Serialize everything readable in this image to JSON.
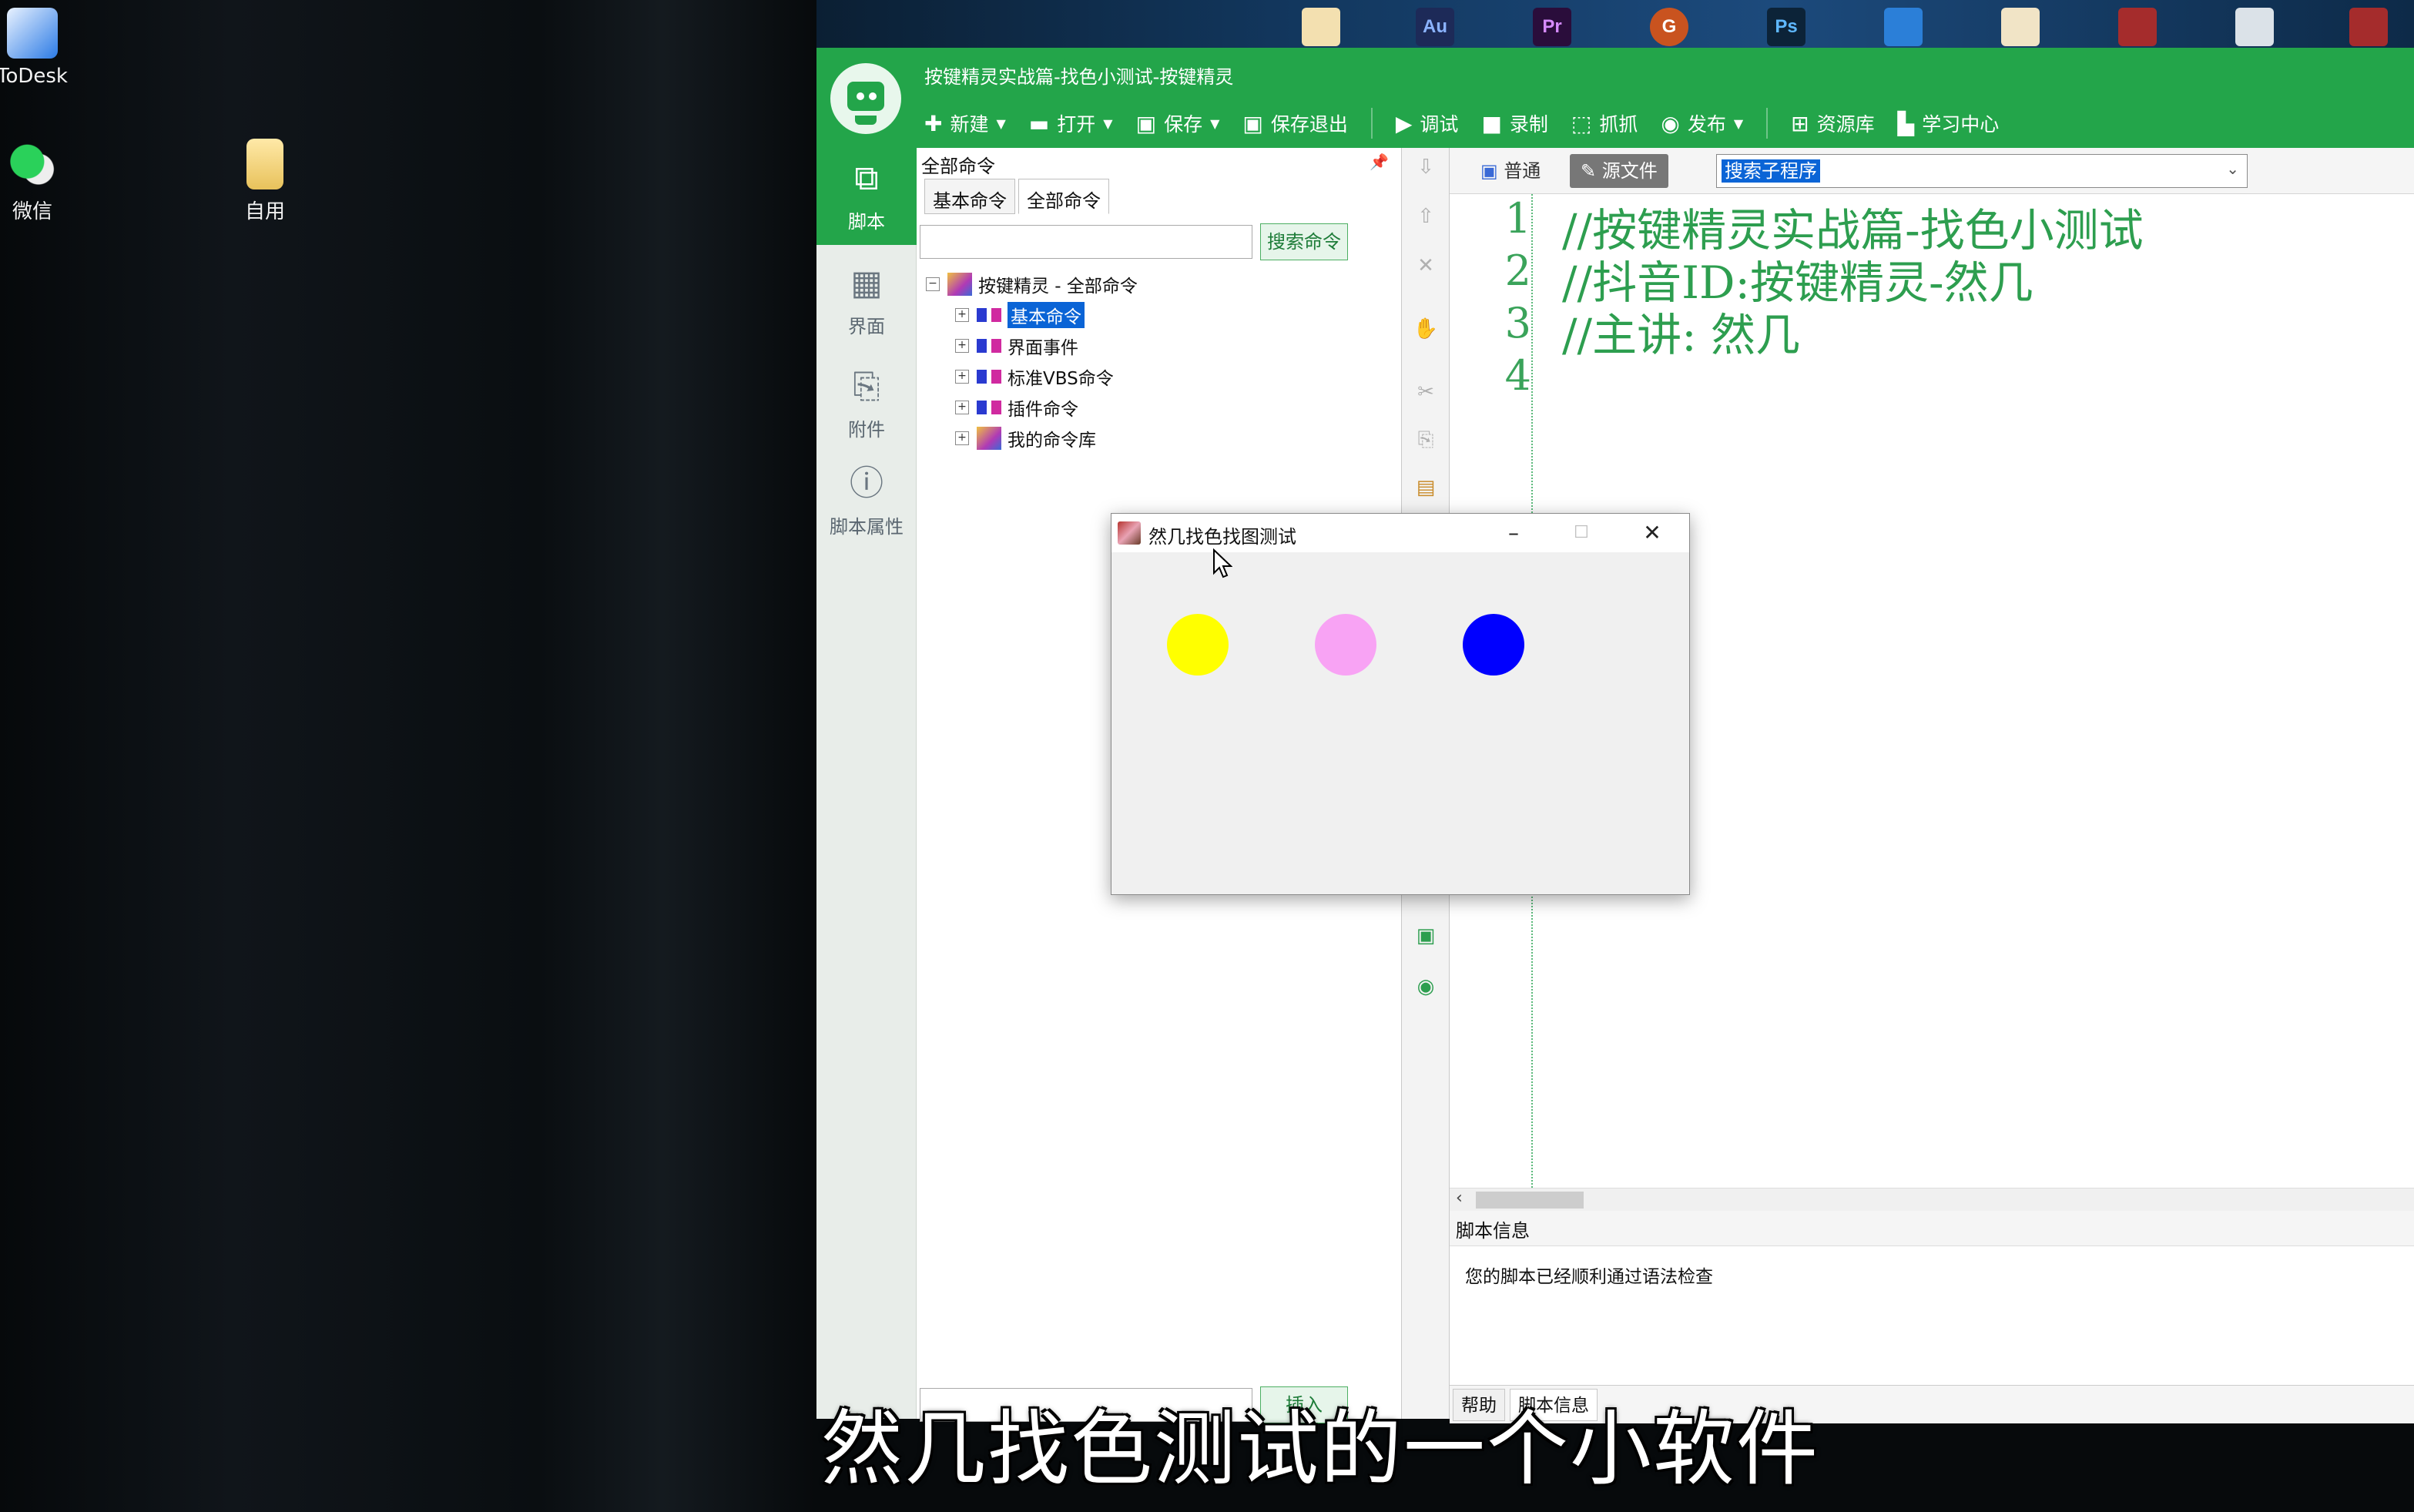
{
  "desktop": {
    "icons": [
      {
        "label": "ToDesk"
      },
      {
        "label": "微信"
      },
      {
        "label": "自用"
      }
    ],
    "taskbar": [
      "Au",
      "Pr",
      "G",
      "Ps"
    ]
  },
  "window": {
    "title": "按键精灵实战篇-找色小测试-按键精灵",
    "toolbar": [
      {
        "label": "新建",
        "icon": "plus-icon"
      },
      {
        "label": "打开",
        "icon": "folder-icon"
      },
      {
        "label": "保存",
        "icon": "save-icon"
      },
      {
        "label": "保存退出",
        "icon": "save-exit-icon"
      },
      {
        "label": "调试",
        "icon": "play-icon"
      },
      {
        "label": "录制",
        "icon": "record-icon"
      },
      {
        "label": "抓抓",
        "icon": "capture-icon"
      },
      {
        "label": "发布",
        "icon": "publish-icon"
      },
      {
        "label": "资源库",
        "icon": "library-icon"
      },
      {
        "label": "学习中心",
        "icon": "learn-icon"
      }
    ]
  },
  "nav": [
    {
      "label": "脚本",
      "active": true
    },
    {
      "label": "界面"
    },
    {
      "label": "附件"
    },
    {
      "label": "脚本属性"
    }
  ],
  "commands": {
    "header": "全部命令",
    "tabs": [
      "基本命令",
      "全部命令"
    ],
    "search_button": "搜索命令",
    "insert_button": "插入",
    "tree_root": "按键精灵 - 全部命令",
    "tree_items": [
      "基本命令",
      "界面事件",
      "标准VBS命令",
      "插件命令",
      "我的命令库"
    ]
  },
  "editor": {
    "mode_normal": "普通",
    "mode_source": "源文件",
    "sub_select": "搜索子程序",
    "lines": [
      {
        "n": "1",
        "text": "//按键精灵实战篇-找色小测试"
      },
      {
        "n": "2",
        "text": "//抖音ID:按键精灵-然几"
      },
      {
        "n": "3",
        "text": "//主讲: 然几"
      },
      {
        "n": "4",
        "text": ""
      }
    ],
    "info_header": "脚本信息",
    "info_message": "您的脚本已经顺利通过语法检查",
    "bottom_tabs": [
      "帮助",
      "脚本信息"
    ]
  },
  "popup": {
    "title": "然几找色找图测试",
    "circles": [
      {
        "color": "#ffff00"
      },
      {
        "color": "#f8a3f4"
      },
      {
        "color": "#0000ff"
      }
    ]
  },
  "subtitle": "然几找色测试的一个小软件",
  "colors": {
    "accent": "#23a54a",
    "code": "#2d9e4f",
    "selection": "#0a64d6"
  }
}
